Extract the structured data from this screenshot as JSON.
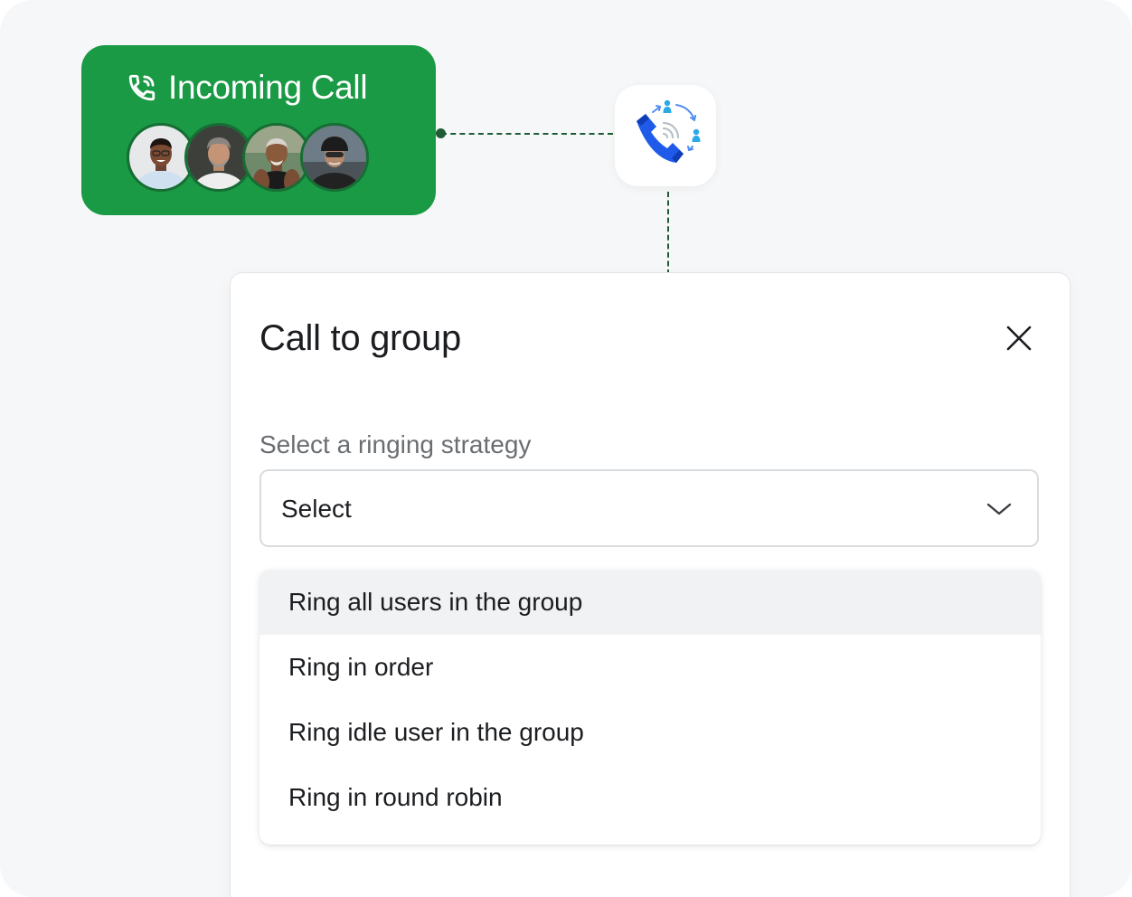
{
  "incoming_call": {
    "title": "Incoming Call",
    "icon": "phone-ringing-icon",
    "avatar_count": 4
  },
  "group_call_icon": "group-call-icon",
  "dialog": {
    "title": "Call to group",
    "close_icon": "close-icon",
    "field_label": "Select a ringing strategy",
    "select": {
      "value": "Select",
      "icon": "chevron-down-icon"
    },
    "options": [
      {
        "label": "Ring all users in the group",
        "highlighted": true
      },
      {
        "label": "Ring in order",
        "highlighted": false
      },
      {
        "label": "Ring idle user in the group",
        "highlighted": false
      },
      {
        "label": "Ring in round robin",
        "highlighted": false
      }
    ]
  },
  "colors": {
    "incoming_bg": "#1a9a45",
    "connector": "#1f5c35",
    "accent_blue": "#1f5be8",
    "option_highlight": "#f1f2f4"
  }
}
